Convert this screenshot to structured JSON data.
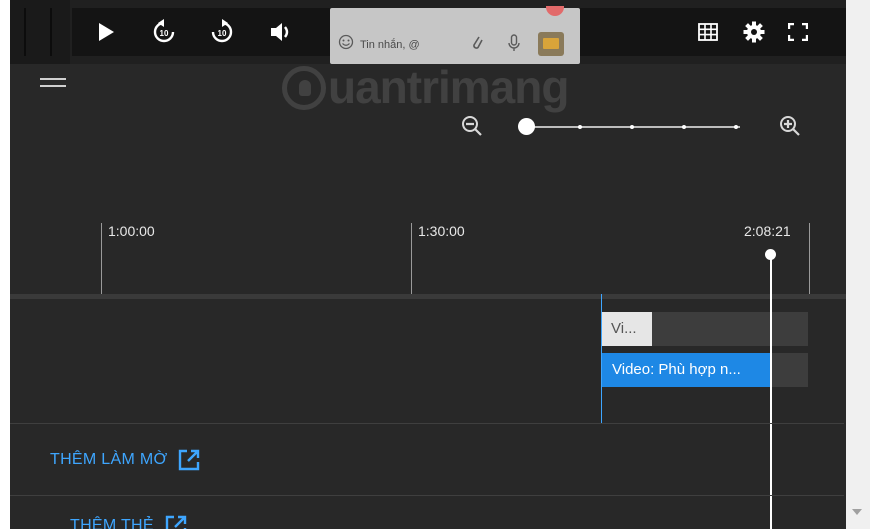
{
  "player": {
    "controls": [
      "play",
      "rewind-10",
      "forward-10",
      "volume"
    ],
    "skip_seconds": "10"
  },
  "chat_overlay": {
    "message_placeholder": "Tin nhắn, @"
  },
  "watermark": {
    "text": "uantrimang"
  },
  "zoom": {
    "level": 0,
    "steps": 5
  },
  "timeline": {
    "ticks": [
      "1:00:00",
      "1:30:00",
      "2:08:21"
    ],
    "playhead_time": "2:08:21"
  },
  "tracks": {
    "clip_a_label": "Vi...",
    "clip_b_label": "Video: Phù hợp n..."
  },
  "actions": {
    "add_blur": "THÊM LÀM MỜ",
    "add_card": "THÊM THẺ"
  },
  "colors": {
    "accent": "#3ea6ff",
    "clip_blue": "#1e88e5",
    "panel_bg": "#282828"
  }
}
